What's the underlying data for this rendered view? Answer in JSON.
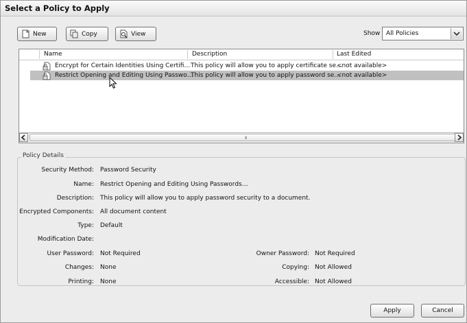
{
  "window": {
    "title": "Select a Policy to Apply"
  },
  "toolbar": {
    "new_label": "New",
    "copy_label": "Copy",
    "view_label": "View",
    "show_label": "Show",
    "show_value": "All Policies"
  },
  "table": {
    "columns": [
      "Name",
      "Description",
      "Last Edited"
    ],
    "rows": [
      {
        "name": "Encrypt for Certain Identities Using Certifi…",
        "description": "This policy will allow you to apply certificate se…",
        "last_edited": "<not available>",
        "selected": false
      },
      {
        "name": "Restrict Opening and Editing Using Passwo…",
        "description": "This policy will allow you to apply password se…",
        "last_edited": "<not available>",
        "selected": true
      }
    ],
    "scroll_grip": "III"
  },
  "details": {
    "legend": "Policy Details",
    "security_method_label": "Security Method:",
    "security_method": "Password Security",
    "name_label": "Name:",
    "name": "Restrict Opening and Editing Using Passwords…",
    "description_label": "Description:",
    "description": "This policy will allow you to apply password security to a document.",
    "encrypted_label": "Encrypted Components:",
    "encrypted": "All document content",
    "type_label": "Type:",
    "type": "Default",
    "modification_label": "Modification Date:",
    "modification": "",
    "user_password_label": "User Password:",
    "user_password": "Not Required",
    "owner_password_label": "Owner Password:",
    "owner_password": "Not Required",
    "changes_label": "Changes:",
    "changes": "None",
    "copying_label": "Copying:",
    "copying": "Not Allowed",
    "printing_label": "Printing:",
    "printing": "None",
    "accessible_label": "Accessible:",
    "accessible": "Not Allowed"
  },
  "buttons": {
    "apply": "Apply",
    "cancel": "Cancel"
  },
  "icons": {
    "new": "new-document-icon",
    "copy": "copy-icon",
    "view": "view-icon",
    "row": "policy-document-icon",
    "dropdown": "chevron-down-icon",
    "cursor": "mouse-pointer-icon"
  }
}
